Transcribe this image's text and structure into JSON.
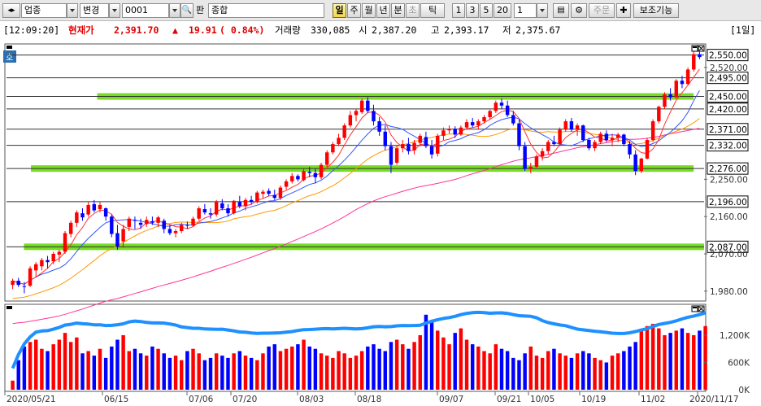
{
  "toolbar": {
    "market": "업종",
    "change_label": "변경",
    "code": "0001",
    "pan_label": "판",
    "index_name": "종합",
    "periods": [
      "일",
      "주",
      "월",
      "년",
      "분",
      "초",
      "틱"
    ],
    "active_period": "일",
    "intervals": [
      "1",
      "3",
      "5",
      "20"
    ],
    "count_value": "1",
    "order_label": "주문",
    "aux_label": "보조기능"
  },
  "infobar": {
    "time": "[12:09:20]",
    "current_label": "현재가",
    "price": "2,391.70",
    "arrow": "▲",
    "change": "19.91",
    "change_pct": "( 0.84%)",
    "volume_label": "거래량",
    "volume": "330,085",
    "open_label": "시",
    "open": "2,387.20",
    "high_label": "고",
    "high": "2,393.17",
    "low_label": "저",
    "low": "2,375.67",
    "period_badge": "[1일]"
  },
  "price_panel": {
    "y_ticks": [
      "2,550.00",
      "2,520.00",
      "2,495.00",
      "2,450.00",
      "2,420.00",
      "2,371.00",
      "2,332.00",
      "2,276.00",
      "2,250.00",
      "2,196.00",
      "2,160.00",
      "2,087.00",
      "2,070.00",
      "1,980.00"
    ],
    "boxed_levels": [
      2550,
      2495,
      2450,
      2420,
      2371,
      2332,
      2276,
      2196,
      2087
    ],
    "plain_levels": [
      2520,
      2250,
      2160,
      2070,
      1980
    ],
    "badge": "호"
  },
  "volume_panel": {
    "y_ticks": [
      "1,200K",
      "600K",
      "0K"
    ]
  },
  "x_labels": [
    "2020/05/21",
    "06/15",
    "07/06",
    "07/20",
    "08/03",
    "08/18",
    "09/07",
    "09/21",
    "10/05",
    "10/19",
    "11/02",
    "2020/11/17"
  ],
  "colors": {
    "up": "#ff0000",
    "down": "#0000ff",
    "zone": "#77dd22",
    "ma5": "#ff3333",
    "ma10": "#3355ff",
    "ma20": "#ff9900",
    "ma60": "#ff3399",
    "volume_line": "#1e90ff"
  },
  "chart_data": {
    "type": "candlestick",
    "candles_ohlc": [
      [
        1995,
        2010,
        1985,
        2005
      ],
      [
        2005,
        2012,
        1990,
        1995
      ],
      [
        1992,
        2002,
        1975,
        1990
      ],
      [
        1993,
        2040,
        1990,
        2035
      ],
      [
        2030,
        2050,
        2015,
        2045
      ],
      [
        2040,
        2060,
        2030,
        2055
      ],
      [
        2055,
        2065,
        2035,
        2050
      ],
      [
        2052,
        2075,
        2045,
        2070
      ],
      [
        2068,
        2080,
        2050,
        2075
      ],
      [
        2075,
        2125,
        2070,
        2120
      ],
      [
        2118,
        2150,
        2110,
        2145
      ],
      [
        2145,
        2175,
        2135,
        2170
      ],
      [
        2168,
        2180,
        2150,
        2158
      ],
      [
        2165,
        2195,
        2160,
        2188
      ],
      [
        2190,
        2200,
        2170,
        2175
      ],
      [
        2178,
        2195,
        2170,
        2188
      ],
      [
        2180,
        2182,
        2150,
        2160
      ],
      [
        2160,
        2165,
        2110,
        2118
      ],
      [
        2120,
        2140,
        2080,
        2088
      ],
      [
        2100,
        2140,
        2085,
        2130
      ],
      [
        2135,
        2160,
        2125,
        2155
      ],
      [
        2152,
        2160,
        2130,
        2150
      ],
      [
        2145,
        2155,
        2130,
        2140
      ],
      [
        2142,
        2160,
        2135,
        2152
      ],
      [
        2148,
        2160,
        2140,
        2145
      ],
      [
        2145,
        2162,
        2135,
        2158
      ],
      [
        2150,
        2155,
        2120,
        2130
      ],
      [
        2130,
        2140,
        2115,
        2120
      ],
      [
        2120,
        2130,
        2110,
        2125
      ],
      [
        2125,
        2145,
        2120,
        2140
      ],
      [
        2140,
        2148,
        2130,
        2138
      ],
      [
        2138,
        2160,
        2135,
        2155
      ],
      [
        2155,
        2185,
        2150,
        2180
      ],
      [
        2178,
        2190,
        2165,
        2170
      ],
      [
        2168,
        2180,
        2155,
        2165
      ],
      [
        2165,
        2200,
        2160,
        2195
      ],
      [
        2192,
        2202,
        2175,
        2180
      ],
      [
        2180,
        2190,
        2160,
        2168
      ],
      [
        2168,
        2200,
        2165,
        2198
      ],
      [
        2195,
        2210,
        2180,
        2185
      ],
      [
        2185,
        2205,
        2175,
        2200
      ],
      [
        2200,
        2210,
        2190,
        2195
      ],
      [
        2195,
        2222,
        2192,
        2218
      ],
      [
        2215,
        2225,
        2205,
        2220
      ],
      [
        2222,
        2228,
        2210,
        2215
      ],
      [
        2212,
        2225,
        2200,
        2205
      ],
      [
        2205,
        2235,
        2200,
        2230
      ],
      [
        2232,
        2250,
        2225,
        2245
      ],
      [
        2245,
        2265,
        2240,
        2258
      ],
      [
        2258,
        2262,
        2245,
        2250
      ],
      [
        2248,
        2275,
        2245,
        2270
      ],
      [
        2268,
        2280,
        2255,
        2265
      ],
      [
        2265,
        2275,
        2240,
        2255
      ],
      [
        2255,
        2290,
        2250,
        2285
      ],
      [
        2285,
        2320,
        2280,
        2315
      ],
      [
        2315,
        2340,
        2310,
        2335
      ],
      [
        2335,
        2360,
        2330,
        2350
      ],
      [
        2350,
        2385,
        2345,
        2380
      ],
      [
        2380,
        2415,
        2375,
        2405
      ],
      [
        2405,
        2420,
        2390,
        2415
      ],
      [
        2412,
        2445,
        2408,
        2440
      ],
      [
        2440,
        2448,
        2410,
        2415
      ],
      [
        2415,
        2430,
        2380,
        2390
      ],
      [
        2390,
        2400,
        2355,
        2365
      ],
      [
        2365,
        2380,
        2320,
        2330
      ],
      [
        2330,
        2340,
        2265,
        2285
      ],
      [
        2290,
        2330,
        2285,
        2325
      ],
      [
        2325,
        2345,
        2315,
        2335
      ],
      [
        2335,
        2350,
        2310,
        2318
      ],
      [
        2320,
        2345,
        2310,
        2338
      ],
      [
        2338,
        2360,
        2330,
        2355
      ],
      [
        2352,
        2365,
        2325,
        2330
      ],
      [
        2330,
        2345,
        2300,
        2310
      ],
      [
        2312,
        2360,
        2305,
        2355
      ],
      [
        2355,
        2375,
        2345,
        2368
      ],
      [
        2368,
        2380,
        2360,
        2372
      ],
      [
        2372,
        2378,
        2350,
        2358
      ],
      [
        2358,
        2380,
        2355,
        2375
      ],
      [
        2375,
        2395,
        2370,
        2388
      ],
      [
        2388,
        2398,
        2375,
        2380
      ],
      [
        2380,
        2395,
        2370,
        2390
      ],
      [
        2390,
        2405,
        2385,
        2400
      ],
      [
        2400,
        2418,
        2395,
        2415
      ],
      [
        2415,
        2440,
        2410,
        2435
      ],
      [
        2435,
        2445,
        2420,
        2428
      ],
      [
        2428,
        2440,
        2400,
        2405
      ],
      [
        2405,
        2415,
        2380,
        2385
      ],
      [
        2385,
        2395,
        2320,
        2330
      ],
      [
        2330,
        2340,
        2270,
        2275
      ],
      [
        2275,
        2290,
        2265,
        2280
      ],
      [
        2280,
        2310,
        2278,
        2305
      ],
      [
        2305,
        2325,
        2295,
        2318
      ],
      [
        2318,
        2345,
        2310,
        2340
      ],
      [
        2340,
        2355,
        2330,
        2335
      ],
      [
        2335,
        2375,
        2330,
        2370
      ],
      [
        2370,
        2395,
        2365,
        2390
      ],
      [
        2390,
        2398,
        2365,
        2370
      ],
      [
        2370,
        2385,
        2355,
        2380
      ],
      [
        2380,
        2382,
        2340,
        2345
      ],
      [
        2345,
        2350,
        2320,
        2325
      ],
      [
        2325,
        2345,
        2318,
        2340
      ],
      [
        2340,
        2365,
        2335,
        2360
      ],
      [
        2360,
        2368,
        2340,
        2345
      ],
      [
        2345,
        2360,
        2330,
        2350
      ],
      [
        2350,
        2362,
        2340,
        2358
      ],
      [
        2358,
        2360,
        2330,
        2335
      ],
      [
        2335,
        2342,
        2300,
        2310
      ],
      [
        2310,
        2320,
        2260,
        2270
      ],
      [
        2270,
        2302,
        2265,
        2300
      ],
      [
        2300,
        2350,
        2298,
        2345
      ],
      [
        2345,
        2395,
        2340,
        2390
      ],
      [
        2390,
        2428,
        2385,
        2425
      ],
      [
        2425,
        2460,
        2420,
        2455
      ],
      [
        2455,
        2470,
        2440,
        2448
      ],
      [
        2448,
        2492,
        2445,
        2488
      ],
      [
        2488,
        2500,
        2470,
        2480
      ],
      [
        2480,
        2520,
        2478,
        2515
      ],
      [
        2515,
        2558,
        2510,
        2552
      ],
      [
        2552,
        2560,
        2540,
        2545
      ]
    ],
    "volume_k": [
      200,
      650,
      950,
      1050,
      1100,
      900,
      850,
      1000,
      1100,
      1250,
      1050,
      1150,
      800,
      850,
      750,
      900,
      700,
      950,
      1100,
      1200,
      850,
      900,
      800,
      750,
      950,
      900,
      800,
      700,
      750,
      650,
      850,
      900,
      800,
      650,
      700,
      800,
      750,
      700,
      800,
      850,
      750,
      700,
      650,
      800,
      950,
      1000,
      850,
      900,
      950,
      1000,
      1100,
      950,
      900,
      800,
      750,
      700,
      850,
      800,
      700,
      750,
      850,
      950,
      1000,
      900,
      850,
      1050,
      1100,
      1000,
      900,
      1050,
      1200,
      1650,
      1500,
      1300,
      1150,
      1000,
      1250,
      1350,
      1100,
      1000,
      950,
      850,
      800,
      1000,
      900,
      850,
      700,
      650,
      800,
      950,
      750,
      700,
      850,
      900,
      800,
      750,
      700,
      800,
      850,
      800,
      700,
      650,
      600,
      750,
      800,
      850,
      950,
      1050,
      1300,
      1400,
      1450,
      1350,
      1200,
      1250,
      1300,
      1350,
      1250,
      1200,
      1300,
      1400
    ],
    "y_range_price": [
      1960,
      2565
    ],
    "y_range_volume_k": [
      0,
      1700
    ],
    "grid": false,
    "legend": "none"
  }
}
